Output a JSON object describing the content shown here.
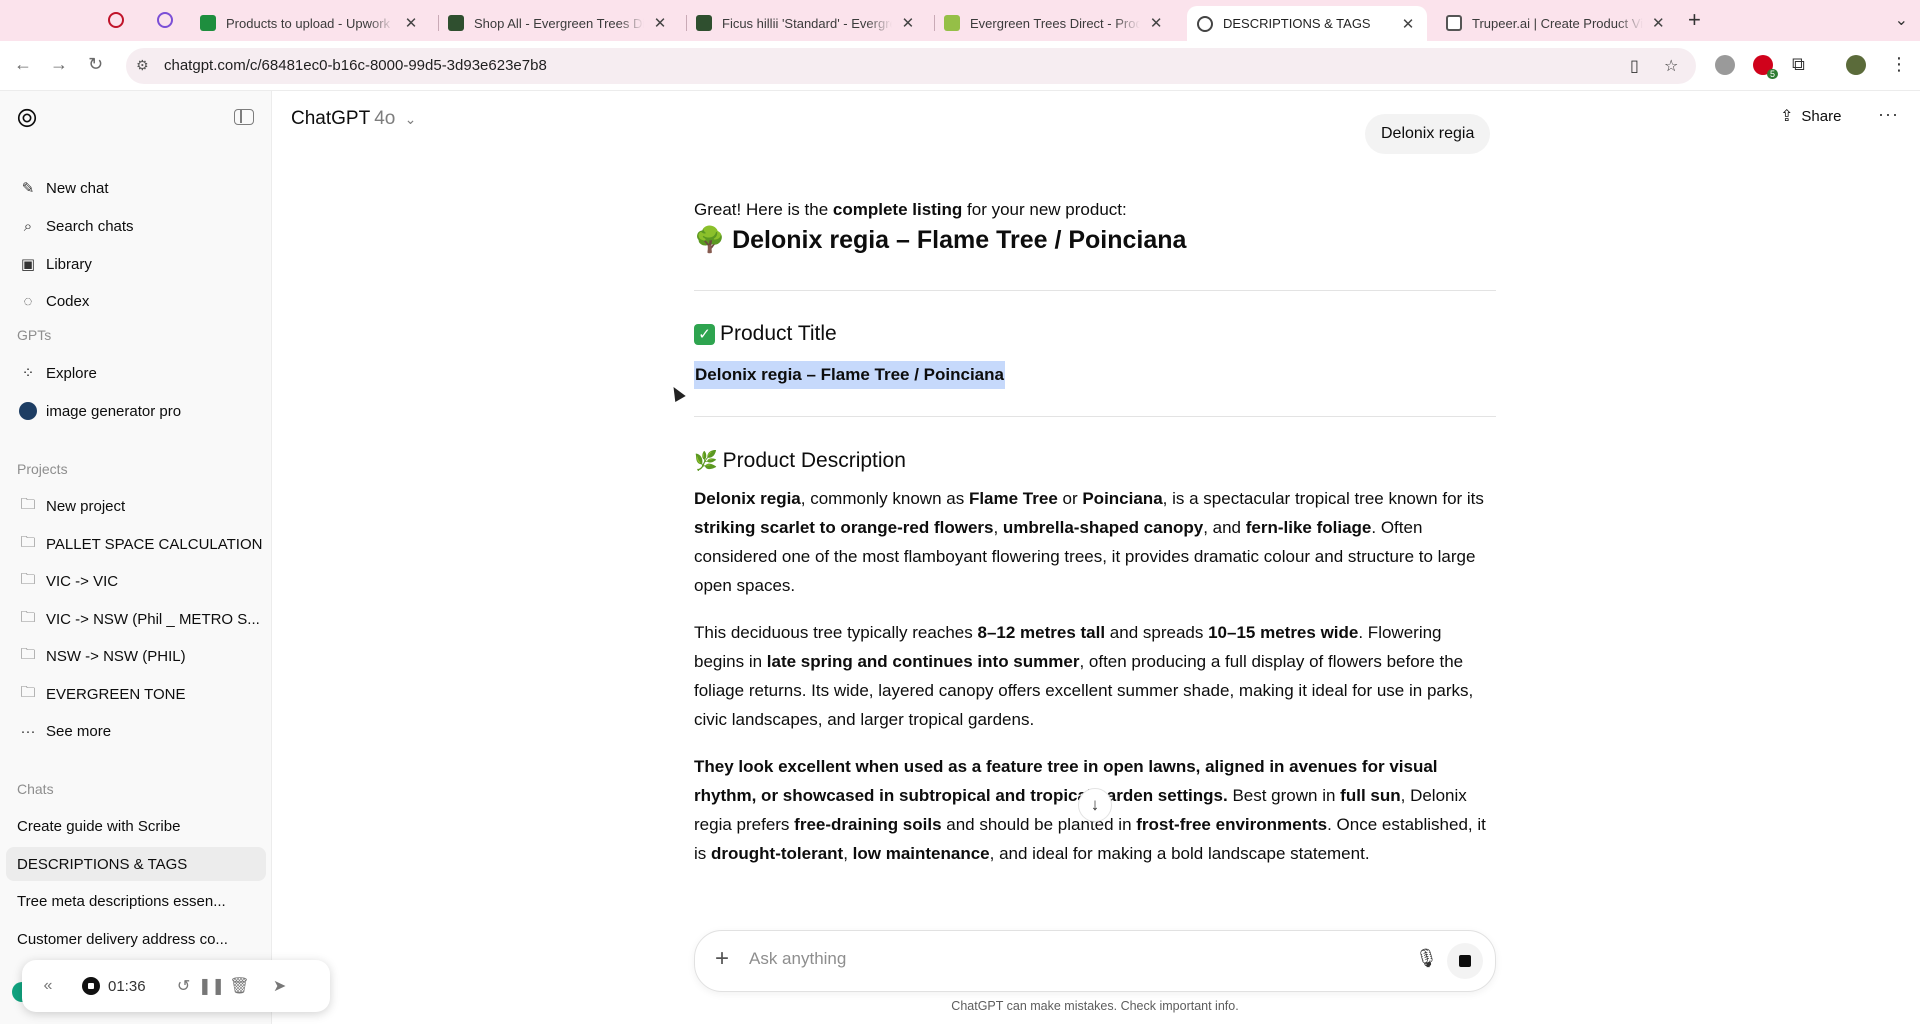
{
  "browser": {
    "tabs": [
      {
        "title": "Products to upload - Upwork",
        "favicon_color": "#1e8e3e"
      },
      {
        "title": "Shop All - Evergreen Trees Direct",
        "favicon_color": "#2f4f2f"
      },
      {
        "title": "Ficus hillii 'Standard' - Evergreen",
        "favicon_color": "#2f4f2f"
      },
      {
        "title": "Evergreen Trees Direct - Products",
        "favicon_color": "#95bf47"
      },
      {
        "title": "DESCRIPTIONS & TAGS",
        "favicon_color": "#444444",
        "active": true
      },
      {
        "title": "Trupeer.ai | Create Product Videos",
        "favicon_color": "#555555"
      }
    ],
    "url": "chatgpt.com/c/68481ec0-b16c-8000-99d5-3d93e623e7b8",
    "extension_badge": "5"
  },
  "sidebar": {
    "top_items": [
      {
        "label": "New chat",
        "icon": "edit-icon"
      },
      {
        "label": "Search chats",
        "icon": "search-icon"
      },
      {
        "label": "Library",
        "icon": "library-icon"
      },
      {
        "label": "Codex",
        "icon": "codex-icon"
      }
    ],
    "gpts_heading": "GPTs",
    "gpts": [
      {
        "label": "Explore",
        "icon": "explore-icon"
      },
      {
        "label": "image generator pro",
        "icon": "gpt-avatar-icon"
      }
    ],
    "projects_heading": "Projects",
    "projects": [
      {
        "label": "New project",
        "icon": "new-folder-icon"
      },
      {
        "label": "PALLET SPACE CALCULATION",
        "icon": "folder-icon"
      },
      {
        "label": "VIC -> VIC",
        "icon": "folder-icon"
      },
      {
        "label": "VIC -> NSW (Phil _ METRO S...",
        "icon": "folder-icon"
      },
      {
        "label": "NSW -> NSW (PHIL)",
        "icon": "folder-icon"
      },
      {
        "label": "EVERGREEN TONE",
        "icon": "folder-icon"
      },
      {
        "label": "See more",
        "icon": "ellipsis-icon"
      }
    ],
    "chats_heading": "Chats",
    "chats": [
      {
        "label": "Create guide with Scribe"
      },
      {
        "label": "DESCRIPTIONS & TAGS",
        "active": true
      },
      {
        "label": "Tree meta descriptions essen..."
      },
      {
        "label": "Customer delivery address co..."
      }
    ]
  },
  "recorder": {
    "time": "01:36"
  },
  "header": {
    "app_name": "ChatGPT",
    "model": "4o",
    "share_label": "Share"
  },
  "conversation": {
    "user_message": "Delonix regia",
    "intro_a": "Great! Here is the ",
    "intro_b": "complete listing",
    "intro_c": " for your new product:",
    "heading_emoji": "🌳",
    "heading": "Delonix regia – Flame Tree / Poinciana",
    "section1_title": "Product Title",
    "product_title": "Delonix regia – Flame Tree / Poinciana",
    "section2_emoji": "🌿",
    "section2_title": "Product Description",
    "p1": [
      {
        "t": "Delonix regia",
        "b": true
      },
      {
        "t": ", commonly known as "
      },
      {
        "t": "Flame Tree",
        "b": true
      },
      {
        "t": " or "
      },
      {
        "t": "Poinciana",
        "b": true
      },
      {
        "t": ", is a spectacular tropical tree known for its "
      },
      {
        "t": "striking scarlet to orange-red flowers",
        "b": true
      },
      {
        "t": ", "
      },
      {
        "t": "umbrella-shaped canopy",
        "b": true
      },
      {
        "t": ", and "
      },
      {
        "t": "fern-like foliage",
        "b": true
      },
      {
        "t": ". Often considered one of the most flamboyant flowering trees, it provides dramatic colour and structure to large open spaces."
      }
    ],
    "p2": [
      {
        "t": "This deciduous tree typically reaches "
      },
      {
        "t": "8–12 metres tall",
        "b": true
      },
      {
        "t": " and spreads "
      },
      {
        "t": "10–15 metres wide",
        "b": true
      },
      {
        "t": ". Flowering begins in "
      },
      {
        "t": "late spring and continues into summer",
        "b": true
      },
      {
        "t": ", often producing a full display of flowers before the foliage returns. Its wide, layered canopy offers excellent summer shade, making it ideal for use in parks, civic landscapes, and larger tropical gardens."
      }
    ],
    "p3": [
      {
        "t": "They look excellent when used as a feature tree in open lawns, aligned in avenues for visual rhythm, or showcased in subtropical and tropical garden settings.",
        "b": true
      },
      {
        "t": " Best grown in "
      },
      {
        "t": "full sun",
        "b": true
      },
      {
        "t": ", Delonix regia prefers "
      },
      {
        "t": "free-draining soils",
        "b": true
      },
      {
        "t": " and should be planted in "
      },
      {
        "t": "frost-free environments",
        "b": true
      },
      {
        "t": ". Once established, it is "
      },
      {
        "t": "drought-tolerant",
        "b": true
      },
      {
        "t": ", "
      },
      {
        "t": "low maintenance",
        "b": true
      },
      {
        "t": ", and ideal for making a bold landscape statement."
      }
    ]
  },
  "composer": {
    "placeholder": "Ask anything",
    "footer_note": "ChatGPT can make mistakes. Check important info."
  }
}
